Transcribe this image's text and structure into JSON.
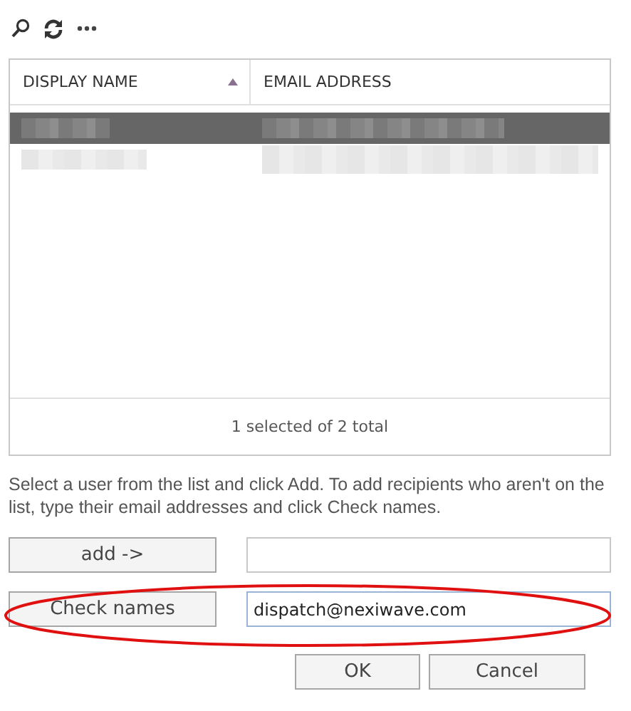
{
  "toolbar": [
    {
      "kind": "search"
    },
    {
      "kind": "refresh"
    },
    {
      "kind": "more"
    }
  ],
  "table": {
    "columns": [
      {
        "label": "DISPLAY NAME",
        "sorted": true
      },
      {
        "label": "EMAIL ADDRESS",
        "sorted": false
      }
    ],
    "rows": [
      {
        "kind": "redacted",
        "selected": true
      },
      {
        "kind": "redacted",
        "selected": false
      }
    ],
    "footer": "1 selected of 2 total"
  },
  "instructions": "Select a user from the list and click Add. To add recipients who aren't on the list, type their email addresses and click Check names.",
  "actions": [
    {
      "button": "add ->",
      "focused": false
    },
    {
      "button": "Check names",
      "value": "dispatch@nexiwave.com",
      "focused": true
    }
  ],
  "buttons": [
    "OK",
    "Cancel"
  ],
  "annotation": {
    "kind": "ellipse"
  }
}
